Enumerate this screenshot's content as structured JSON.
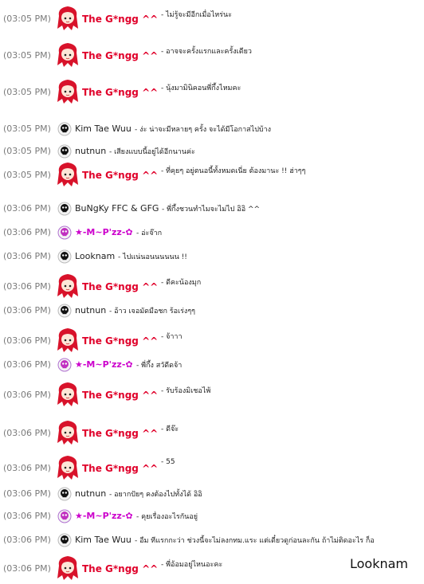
{
  "chat": {
    "messages": [
      {
        "time": "(03:05 PM)",
        "user": "The G*ngg ^^",
        "avatar": "red-hair-girl-avatar",
        "text": "- ไม่รู้จะมีอีกเมื่อไหร่นะ",
        "style": "gang"
      },
      {
        "time": "(03:05 PM)",
        "user": "The G*ngg ^^",
        "avatar": "red-hair-girl-avatar",
        "text": "- อาจจะครั้งแรกและครั้งเดียว",
        "style": "gang"
      },
      {
        "time": "(03:05 PM)",
        "user": "The G*ngg ^^",
        "avatar": "red-hair-girl-avatar",
        "text": "- นุ้งมามินิคอนพี่กึ้งไหมคะ",
        "style": "gang"
      },
      {
        "time": "(03:05 PM)",
        "user": "Kim Tae Wuu",
        "avatar": "skull-face-icon",
        "text": "- ง่ะ น่าจะมีหลายๆ ครั้ง จะได้มีโอกาสไปบ้าง",
        "style": "other"
      },
      {
        "time": "(03:05 PM)",
        "user": "nutnun",
        "avatar": "skull-face-icon",
        "text": "- เสียงแบบนี้อยู่ได้อีกนานค่ะ",
        "style": "other"
      },
      {
        "time": "(03:05 PM)",
        "user": "The G*ngg ^^",
        "avatar": "red-hair-girl-avatar",
        "text": "- ที่คุยๆ อยู่ตนอนี้ทั้งหมดเนี่ย ต้องมานะ !! ฮ่าๆๆ",
        "style": "gang"
      },
      {
        "time": "(03:06 PM)",
        "user": "BuNgKy FFC & GFG",
        "avatar": "skull-face-icon",
        "text": "- พี่กึ้งชวนทำไมจะไม่ไป อิอิ ^^",
        "style": "other"
      },
      {
        "time": "(03:06 PM)",
        "user": "★-M~P'zz-✿",
        "avatar": "pink-skull-icon",
        "text": "- อ่ะจ๊าก",
        "style": "mpzz"
      },
      {
        "time": "(03:06 PM)",
        "user": "Looknam",
        "avatar": "skull-face-icon",
        "text": "- ไปแน่นอนนนนนน !!",
        "style": "other"
      },
      {
        "time": "(03:06 PM)",
        "user": "The G*ngg ^^",
        "avatar": "red-hair-girl-avatar",
        "text": "- ดีคะน้องมุก",
        "style": "gang"
      },
      {
        "time": "(03:06 PM)",
        "user": "nutnun",
        "avatar": "skull-face-icon",
        "text": "- อ้าว เจอมัดมือชก ร้อเร่งๆๆ",
        "style": "other"
      },
      {
        "time": "(03:06 PM)",
        "user": "The G*ngg ^^",
        "avatar": "red-hair-girl-avatar",
        "text": "- จ้าาา",
        "style": "gang"
      },
      {
        "time": "(03:06 PM)",
        "user": "★-M~P'zz-✿",
        "avatar": "pink-skull-icon",
        "text": "- พี่กึ้ง สวัดีดจ้า",
        "style": "mpzz"
      },
      {
        "time": "(03:06 PM)",
        "user": "The G*ngg ^^",
        "avatar": "red-hair-girl-avatar",
        "text": "- รับร้องมิเชอไพ้",
        "style": "gang"
      },
      {
        "time": "(03:06 PM)",
        "user": "The G*ngg ^^",
        "avatar": "red-hair-girl-avatar",
        "text": "- ดีจ๊ะ",
        "style": "gang"
      },
      {
        "time": "(03:06 PM)",
        "user": "The G*ngg ^^",
        "avatar": "red-hair-girl-avatar",
        "text": "- 55",
        "style": "gang"
      },
      {
        "time": "(03:06 PM)",
        "user": "nutnun",
        "avatar": "skull-face-icon",
        "text": "- อยากปัยๆ คงต้องไปทั้งได้ อิอิ",
        "style": "other"
      },
      {
        "time": "(03:06 PM)",
        "user": "★-M~P'zz-✿",
        "avatar": "pink-skull-icon",
        "text": "- คุยเรื่องอะไรกันอยู่",
        "style": "mpzz"
      },
      {
        "time": "(03:06 PM)",
        "user": "Kim Tae Wuu",
        "avatar": "skull-face-icon",
        "text": "- อืม ทีแรกกะว่า ช่วงนี้จะไม่ลงกทม.แระ แต่เดี๋ยวดูก่อนละกัน ถ้าไม่ติดอะไร ก็อ",
        "style": "other"
      },
      {
        "time": "(03:06 PM)",
        "user": "The G*ngg ^^",
        "avatar": "red-hair-girl-avatar",
        "text": "- พี่อ้อมอยู่ไหนอะคะ",
        "style": "gang"
      }
    ]
  },
  "tooltip": {
    "text": "Looknam"
  },
  "colors": {
    "gang": "#e0002a",
    "mpzz": "#cc00cc",
    "timestamp": "#7a7a7a"
  }
}
